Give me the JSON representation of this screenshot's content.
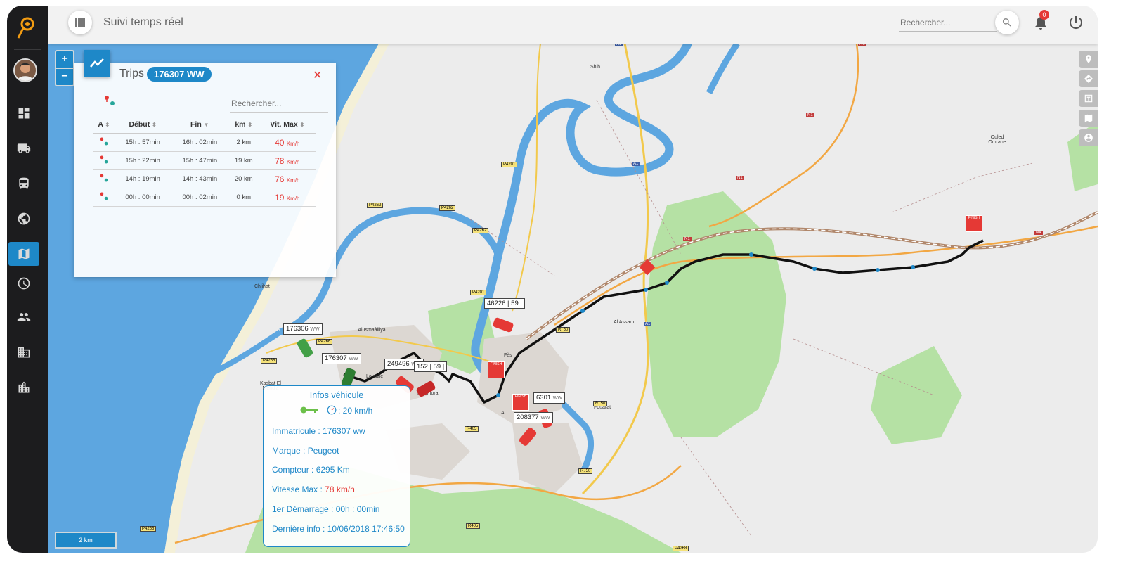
{
  "header": {
    "title": "Suivi temps réel",
    "search_placeholder": "Rechercher...",
    "notification_count": "0"
  },
  "sidebar": {
    "items": [
      {
        "icon": "dashboard-icon"
      },
      {
        "icon": "truck-icon"
      },
      {
        "icon": "bus-icon"
      },
      {
        "icon": "globe-icon"
      },
      {
        "icon": "map-icon",
        "active": true
      },
      {
        "icon": "clock-icon"
      },
      {
        "icon": "people-icon"
      },
      {
        "icon": "building-icon"
      },
      {
        "icon": "city-icon"
      }
    ]
  },
  "map": {
    "scale_label": "2 km",
    "zoom_in": "+",
    "zoom_out": "−",
    "places": [
      "Shih",
      "Ouled Omrane",
      "Chlihat",
      "Al Ismaâiliya",
      "Kasbat El Mehdia",
      "Le valle",
      "Maamora",
      "Fès",
      "Al Assam",
      "Fouarat",
      "Al"
    ],
    "roads": [
      "A1",
      "N1",
      "N4",
      "P4201",
      "P4262",
      "P4266",
      "R405",
      "R. 50",
      "R. 20",
      "P4268"
    ],
    "markers": [
      "FINISH"
    ],
    "vehicle_labels": [
      {
        "id": "176306",
        "suffix": "WW"
      },
      {
        "id": "176307",
        "suffix": "WW"
      },
      {
        "id": "249496",
        "suffix": "WW"
      },
      {
        "id": "152 | 59 |",
        "suffix": ""
      },
      {
        "id": "46226 | 59 |",
        "suffix": ""
      },
      {
        "id": "6301",
        "suffix": "WW"
      },
      {
        "id": "208377",
        "suffix": "WW"
      }
    ]
  },
  "trips": {
    "title": "Trips",
    "plate": "176307 WW",
    "search_placeholder": "Rechercher...",
    "columns": [
      "A",
      "Début",
      "Fin",
      "km",
      "Vit. Max"
    ],
    "rows": [
      {
        "debut": "15h : 57min",
        "fin": "16h : 02min",
        "km": "2 km",
        "vmax": "40",
        "unit": "Km/h"
      },
      {
        "debut": "15h : 22min",
        "fin": "15h : 47min",
        "km": "19 km",
        "vmax": "78",
        "unit": "Km/h"
      },
      {
        "debut": "14h : 19min",
        "fin": "14h : 43min",
        "km": "20 km",
        "vmax": "76",
        "unit": "Km/h"
      },
      {
        "debut": "00h : 00min",
        "fin": "00h : 02min",
        "km": "0 km",
        "vmax": "19",
        "unit": "Km/h"
      }
    ]
  },
  "info": {
    "title": "Infos véhicule",
    "speed": ": 20 km/h",
    "immatricule": "Immatricule : 176307 ww",
    "marque": "Marque : Peugeot",
    "compteur": "Compteur : 6295 Km",
    "vitesse_label": "Vitesse Max : ",
    "vitesse_value": "78 km/h",
    "demarrage": "1er Démarrage : 00h : 00min",
    "derniere": "Dernière info : 10/06/2018 17:46:50"
  },
  "colors": {
    "accent": "#1e88c8",
    "danger": "#e53935",
    "water": "#5da6e0",
    "land": "#ececec",
    "park": "#b5e1a4",
    "route": "#111111"
  }
}
